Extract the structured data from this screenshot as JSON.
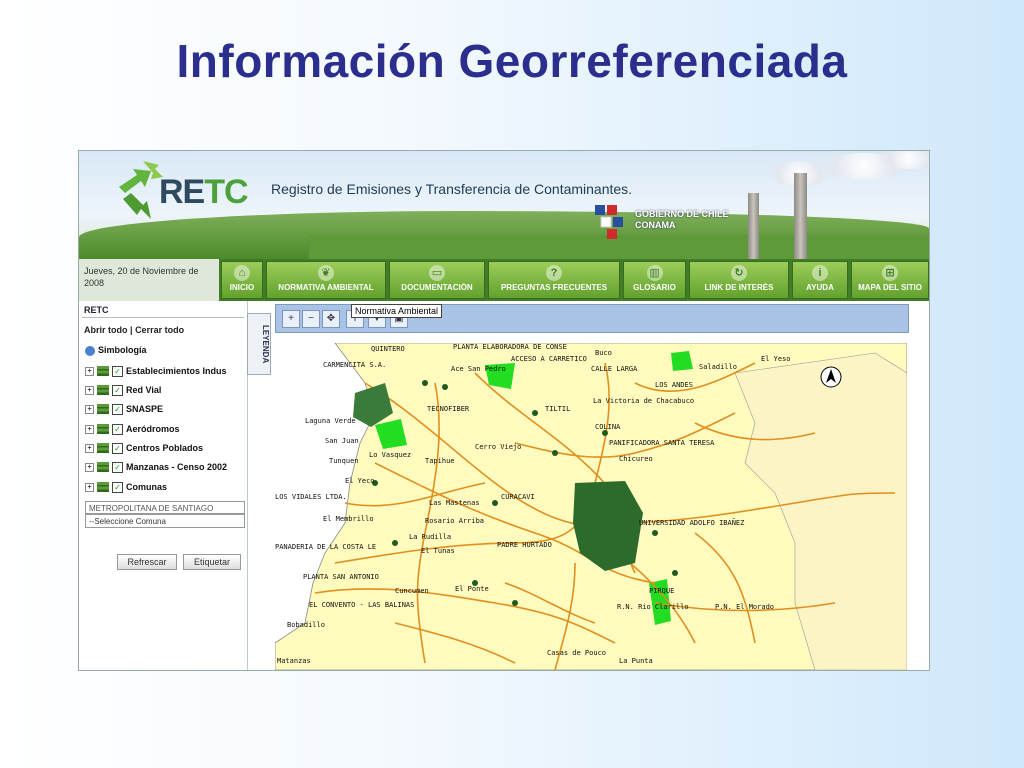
{
  "slide": {
    "title": "Información Georreferenciada"
  },
  "site": {
    "logo_text_a": "RE",
    "logo_text_b": "TC",
    "subtitle": "Registro de Emisiones y Transferencia de Contaminantes.",
    "gob_line1": "GOBIERNO DE CHILE",
    "gob_line2": "CONAMA",
    "date": "Jueves, 20 de Noviembre de 2008"
  },
  "nav": {
    "items": [
      {
        "label": "INICIO",
        "icon": "home-icon"
      },
      {
        "label": "NORMATIVA AMBIENTAL",
        "icon": "leaf-icon"
      },
      {
        "label": "DOCUMENTACIÓN",
        "icon": "folder-icon"
      },
      {
        "label": "PREGUNTAS FRECUENTES",
        "icon": "question-icon"
      },
      {
        "label": "GLOSARIO",
        "icon": "book-icon"
      },
      {
        "label": "LINK DE INTERÉS",
        "icon": "refresh-icon"
      },
      {
        "label": "AYUDA",
        "icon": "info-icon"
      },
      {
        "label": "MAPA DEL SITIO",
        "icon": "sitemap-icon"
      }
    ]
  },
  "left_panel": {
    "title": "RETC",
    "open_all": "Abrir todo",
    "separator": "|",
    "close_all": "Cerrar todo",
    "symbology": "Simbología",
    "layers": [
      "Establecimientos Indus",
      "Red Vial",
      "SNASPE",
      "Aeródromos",
      "Centros Poblados",
      "Manzanas - Censo 2002",
      "Comunas"
    ],
    "region": "METROPOLITANA DE SANTIAGO",
    "comuna_select": "--Seleccione Comuna",
    "refresh_button": "Refrescar",
    "label_button": "Etiquetar",
    "legend_tab": "LEYENDA"
  },
  "toolbar": {
    "tooltip": "Normativa Ambiental"
  },
  "map": {
    "places": [
      "QUINTERO",
      "CARMENCITA S.A.",
      "Ace San Pedro",
      "PLANTA ELABORADORA DE CONSE",
      "ACCESO A CARRETICO",
      "Buco",
      "CALLE LARGA",
      "Saladillo",
      "El Yeso",
      "LOS ANDES",
      "TECNOFIBER",
      "TILTIL",
      "La Victoria de Chacabuco",
      "Laguna Verde",
      "San Juan",
      "Lo Vasquez",
      "Tapihue",
      "Cerro Viejo",
      "COLINA",
      "PANIFICADORA SANTA TERESA",
      "Chicureo",
      "Tunquen",
      "El Yeco",
      "LOS VIDALES LTDA.",
      "Las Mastenas",
      "CURACAVI",
      "El Membrillo",
      "Rosario Arriba",
      "UNIVERSIDAD ADOLFO IBAÑEZ",
      "PANADERIA DE LA COSTA LE",
      "La Rudilla",
      "El Tunas",
      "PADRE HURTADO",
      "PLANTA SAN ANTONIO",
      "Cuncumen",
      "El Ponte",
      "EL CONVENTO - LAS BALINAS",
      "Bobadillo",
      "R.N. Rio Clarillo",
      "P.N. El Morado",
      "Matanzas",
      "Casas de Pouco",
      "La Punta",
      "PIRQUE"
    ]
  }
}
